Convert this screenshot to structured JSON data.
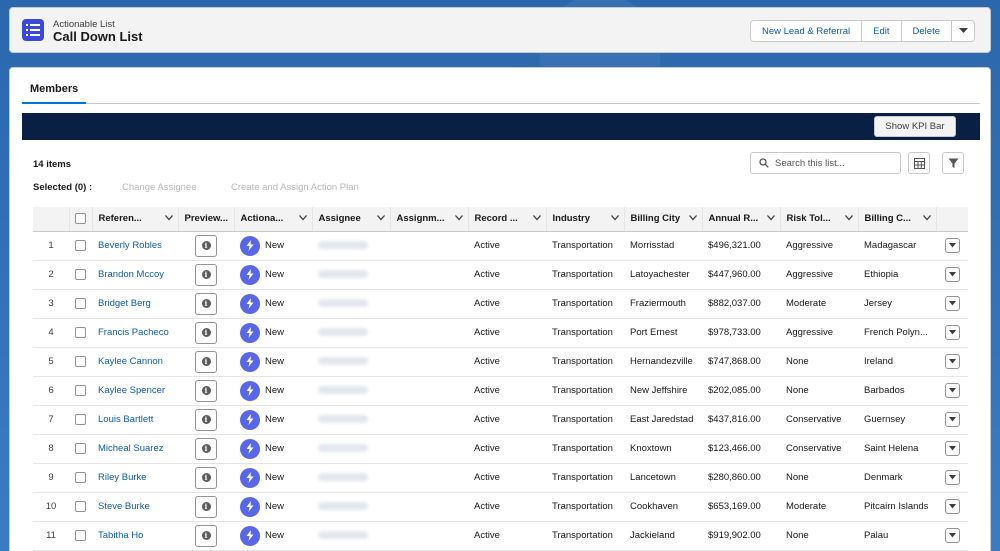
{
  "header": {
    "object_type": "Actionable List",
    "title": "Call Down List",
    "buttons": [
      "New Lead & Referral",
      "Edit",
      "Delete"
    ]
  },
  "tabs": [
    {
      "label": "Members",
      "active": true
    }
  ],
  "kpi": {
    "button_label": "Show KPI Bar"
  },
  "list": {
    "items_count": "14 items",
    "selected": "Selected (0) :",
    "actions": [
      "Change Assignee",
      "Create and Assign Action Plan"
    ],
    "search_placeholder": "Search this list..."
  },
  "columns": [
    "Referen...",
    "Preview...",
    "Actiona...",
    "Assignee",
    "Assignm...",
    "Record ...",
    "Industry",
    "Billing City",
    "Annual R...",
    "Risk Tol...",
    "Billing C..."
  ],
  "rows": [
    {
      "n": "1",
      "name": "Beverly Robles",
      "action": "New",
      "status": "Active",
      "industry": "Transportation",
      "city": "Morrisstad",
      "revenue": "$496,321.00",
      "risk": "Aggressive",
      "country": "Madagascar"
    },
    {
      "n": "2",
      "name": "Brandon Mccoy",
      "action": "New",
      "status": "Active",
      "industry": "Transportation",
      "city": "Latoyachester",
      "revenue": "$447,960.00",
      "risk": "Aggressive",
      "country": "Ethiopia"
    },
    {
      "n": "3",
      "name": "Bridget Berg",
      "action": "New",
      "status": "Active",
      "industry": "Transportation",
      "city": "Fraziermouth",
      "revenue": "$882,037.00",
      "risk": "Moderate",
      "country": "Jersey"
    },
    {
      "n": "4",
      "name": "Francis Pacheco",
      "action": "New",
      "status": "Active",
      "industry": "Transportation",
      "city": "Port Ernest",
      "revenue": "$978,733.00",
      "risk": "Aggressive",
      "country": "French Polyn..."
    },
    {
      "n": "5",
      "name": "Kaylee Cannon",
      "action": "New",
      "status": "Active",
      "industry": "Transportation",
      "city": "Hernandezville",
      "revenue": "$747,868.00",
      "risk": "None",
      "country": "Ireland"
    },
    {
      "n": "6",
      "name": "Kaylee Spencer",
      "action": "New",
      "status": "Active",
      "industry": "Transportation",
      "city": "New Jeffshire",
      "revenue": "$202,085.00",
      "risk": "None",
      "country": "Barbados"
    },
    {
      "n": "7",
      "name": "Louis Bartlett",
      "action": "New",
      "status": "Active",
      "industry": "Transportation",
      "city": "East Jaredstad",
      "revenue": "$437,816.00",
      "risk": "Conservative",
      "country": "Guernsey"
    },
    {
      "n": "8",
      "name": "Micheal Suarez",
      "action": "New",
      "status": "Active",
      "industry": "Transportation",
      "city": "Knoxtown",
      "revenue": "$123,466.00",
      "risk": "Conservative",
      "country": "Saint Helena"
    },
    {
      "n": "9",
      "name": "Riley Burke",
      "action": "New",
      "status": "Active",
      "industry": "Transportation",
      "city": "Lancetown",
      "revenue": "$280,860.00",
      "risk": "None",
      "country": "Denmark"
    },
    {
      "n": "10",
      "name": "Steve Burke",
      "action": "New",
      "status": "Active",
      "industry": "Transportation",
      "city": "Cookhaven",
      "revenue": "$653,169.00",
      "risk": "Moderate",
      "country": "Pitcairn Islands"
    },
    {
      "n": "11",
      "name": "Tabitha Ho",
      "action": "New",
      "status": "Active",
      "industry": "Transportation",
      "city": "Jackieland",
      "revenue": "$919,902.00",
      "risk": "None",
      "country": "Palau"
    }
  ],
  "colors": {
    "brand": "#0176d3",
    "link": "#0b5cab",
    "kpi_bar": "#0a1f44",
    "bolt": "#5867e8",
    "object_icon": "#3a49d9"
  },
  "icons": {
    "object": "list-icon",
    "search": "search-icon",
    "table_view": "table-icon",
    "filter": "filter-icon",
    "preview": "info-icon",
    "action": "lightning-icon",
    "row_menu": "chevron-down-icon"
  }
}
